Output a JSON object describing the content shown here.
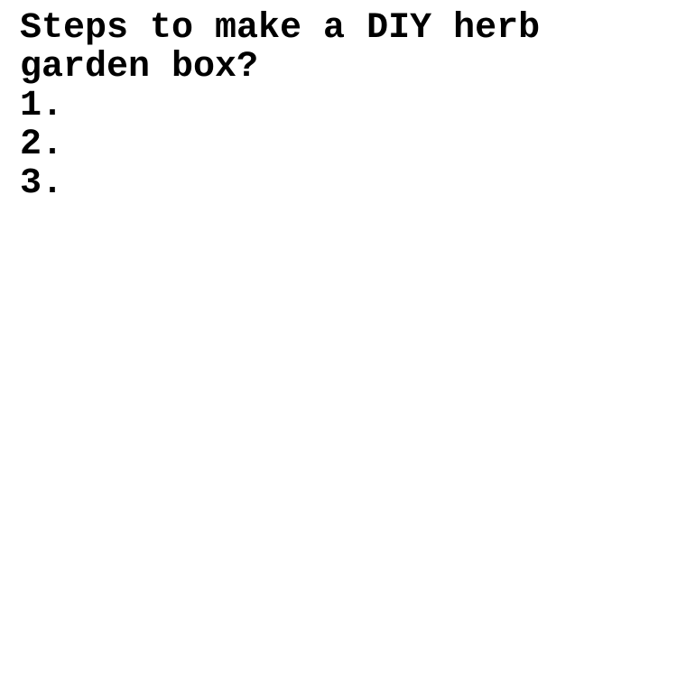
{
  "document": {
    "title_line1": "Steps to make a DIY herb",
    "title_line2": "garden box?",
    "steps": [
      {
        "label": "1."
      },
      {
        "label": "2."
      },
      {
        "label": "3."
      }
    ]
  }
}
